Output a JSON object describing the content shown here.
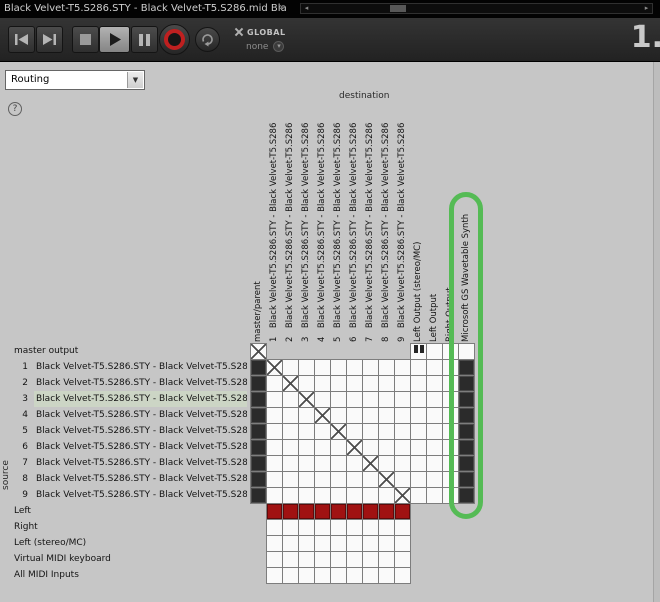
{
  "titlebar": {
    "title": "Black Velvet-T5.S286.STY - Black Velvet-T5.S286.mid Bla",
    "collapse_icon": "«"
  },
  "scrollbar": {
    "left_arrow": "◂",
    "right_arrow": "▸"
  },
  "toolbar": {
    "global_label": "GLOBAL",
    "global_value": "none",
    "chevron_icon": "▾",
    "page_number": "1."
  },
  "view": {
    "selector_value": "Routing",
    "dropdown_arrow": "▼",
    "help_icon": "?"
  },
  "colors": {
    "highlight_green": "#55bb55",
    "matrix_filled": "#2b2b2b",
    "matrix_red": "#a01212"
  },
  "matrix": {
    "destination_label": "destination",
    "source_label": "source",
    "columns": [
      {
        "label": "master/parent"
      },
      {
        "num": "1",
        "label": "Black Velvet-T5.S286.STY - Black Velvet-T5.S286"
      },
      {
        "num": "2",
        "label": "Black Velvet-T5.S286.STY - Black Velvet-T5.S286"
      },
      {
        "num": "3",
        "label": "Black Velvet-T5.S286.STY - Black Velvet-T5.S286"
      },
      {
        "num": "4",
        "label": "Black Velvet-T5.S286.STY - Black Velvet-T5.S286"
      },
      {
        "num": "5",
        "label": "Black Velvet-T5.S286.STY - Black Velvet-T5.S286"
      },
      {
        "num": "6",
        "label": "Black Velvet-T5.S286.STY - Black Velvet-T5.S286"
      },
      {
        "num": "7",
        "label": "Black Velvet-T5.S286.STY - Black Velvet-T5.S286"
      },
      {
        "num": "8",
        "label": "Black Velvet-T5.S286.STY - Black Velvet-T5.S286"
      },
      {
        "num": "9",
        "label": "Black Velvet-T5.S286.STY - Black Velvet-T5.S286"
      },
      {
        "label": "Left Output (stereo/MC)"
      },
      {
        "label": "Left Output"
      },
      {
        "label": "Right Output"
      },
      {
        "label": "Microsoft GS Wavetable Synth",
        "highlighted": true
      }
    ],
    "rows": [
      {
        "label": "master output"
      },
      {
        "num": "1",
        "label": "Black Velvet-T5.S286.STY - Black Velvet-T5.S28"
      },
      {
        "num": "2",
        "label": "Black Velvet-T5.S286.STY - Black Velvet-T5.S28"
      },
      {
        "num": "3",
        "label": "Black Velvet-T5.S286.STY - Black Velvet-T5.S28",
        "selected": true
      },
      {
        "num": "4",
        "label": "Black Velvet-T5.S286.STY - Black Velvet-T5.S28"
      },
      {
        "num": "5",
        "label": "Black Velvet-T5.S286.STY - Black Velvet-T5.S28"
      },
      {
        "num": "6",
        "label": "Black Velvet-T5.S286.STY - Black Velvet-T5.S28"
      },
      {
        "num": "7",
        "label": "Black Velvet-T5.S286.STY - Black Velvet-T5.S28"
      },
      {
        "num": "8",
        "label": "Black Velvet-T5.S286.STY - Black Velvet-T5.S28"
      },
      {
        "num": "9",
        "label": "Black Velvet-T5.S286.STY - Black Velvet-T5.S28"
      },
      {
        "label": "Left"
      },
      {
        "label": "Right"
      },
      {
        "label": "Left (stereo/MC)"
      },
      {
        "label": "Virtual MIDI keyboard"
      },
      {
        "label": "All MIDI Inputs"
      }
    ],
    "grid": [
      "x.........iooo",
      "fxooooooooooof",
      "foxoooooooooof",
      "fooxooooooooof",
      "foooxoooooooof",
      "fooooxooooooof",
      "foooooxoooooof",
      "fooooooxooooof",
      "foooooooxoooof",
      "fooooooooxooof",
      ".rrrrrrrrr....",
      ".ooooooooo....",
      ".ooooooooo....",
      ".ooooooooo....",
      ".ooooooooo...."
    ]
  }
}
